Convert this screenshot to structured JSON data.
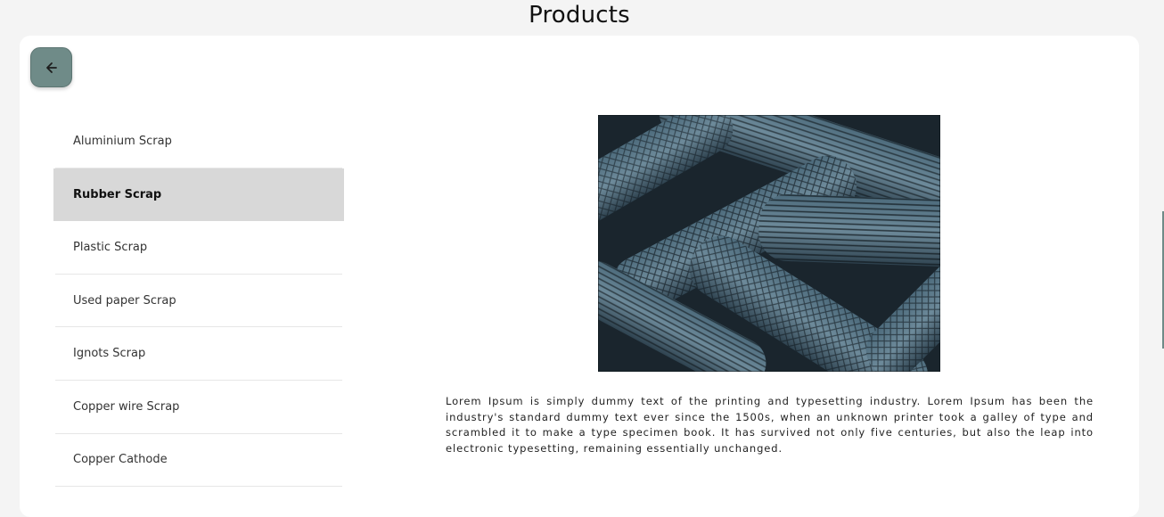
{
  "page": {
    "title": "Products"
  },
  "back_button": {
    "icon": "arrow-left-icon",
    "color": "#6f8b88"
  },
  "categories": [
    {
      "label": "Aluminium Scrap",
      "active": false
    },
    {
      "label": "Rubber Scrap",
      "active": true
    },
    {
      "label": "Plastic Scrap",
      "active": false
    },
    {
      "label": "Used paper Scrap",
      "active": false
    },
    {
      "label": "Ignots Scrap",
      "active": false
    },
    {
      "label": "Copper wire Scrap",
      "active": false
    },
    {
      "label": "Copper Cathode",
      "active": false
    }
  ],
  "product": {
    "image": "rubber-tires-photo",
    "description": "Lorem Ipsum is simply dummy text of the printing and typesetting industry. Lorem Ipsum has been the industry's standard dummy text ever since the 1500s, when an unknown printer took a galley of type and scrambled it to make a type specimen book. It has survived not only five centuries, but also the leap into electronic typesetting, remaining essentially unchanged."
  }
}
